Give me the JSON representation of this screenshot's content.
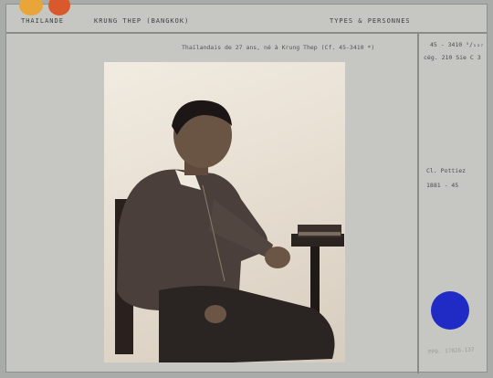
{
  "header": {
    "country": "THAILANDE",
    "place": "KRUNG THEP (BANGKOK)",
    "category": "TYPES & PERSONNES"
  },
  "caption": "Thaïlandais de 27 ans, né à Krung Thep (Cf. 45-3410 *)",
  "side_notes": {
    "ref_line1": "45 - 3410 ⁵/₁₃₇",
    "ref_line2": "cég. 210  Sie C 3",
    "collection": "Cl. Pottiez",
    "year": "1881 - 45",
    "stamp": "PP0. 17826.137"
  },
  "colors": {
    "card": "#c6c7c3",
    "accent_yellow": "#e8a53a",
    "accent_orange": "#d9592d",
    "blue_dot": "#1f2bc4"
  }
}
